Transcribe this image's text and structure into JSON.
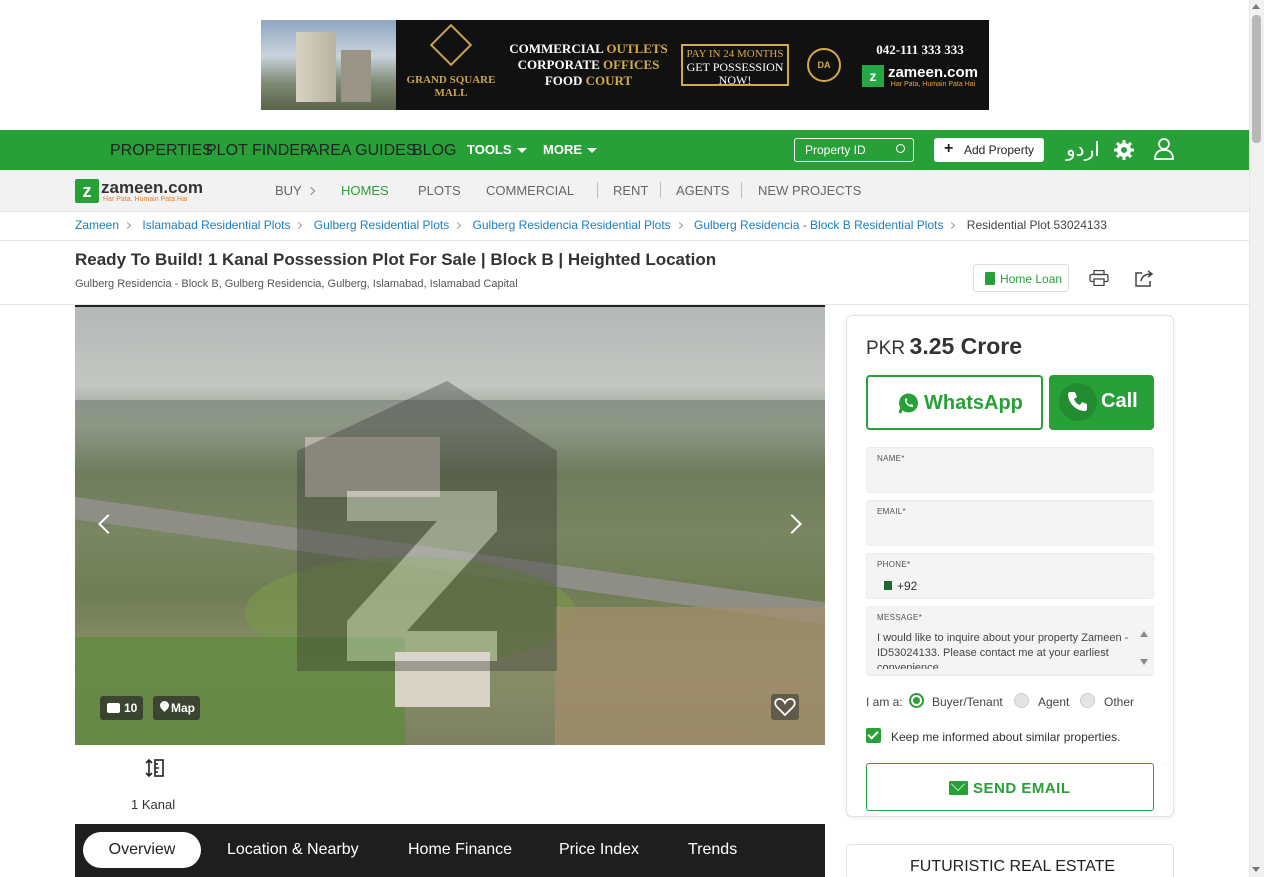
{
  "ad": {
    "logo_label": "GRAND SQUARE MALL",
    "line1_a": "COMMERCIAL",
    "line1_b": "OUTLETS",
    "line2_a": "CORPORATE",
    "line2_b": "OFFICES",
    "line3_a": "FOOD",
    "line3_b": "COURT",
    "pay_top": "PAY IN 24 MONTHS",
    "pay_bottom": "GET POSSESSION NOW!",
    "phone": "042-111 333 333",
    "brand": "zameen.com",
    "brand_tag": "Har Pata, Humain Pata Hai"
  },
  "topnav": {
    "items": [
      "PROPERTIES",
      "PLOT FINDER",
      "AREA GUIDES",
      "BLOG",
      "TOOLS",
      "MORE"
    ],
    "search_placeholder": "Property ID",
    "add_property": "Add Property",
    "urdu": "اردو"
  },
  "brand": {
    "name": "zameen.com",
    "tag": "Har Pata, Humain Pata Hai"
  },
  "subnav": {
    "items": [
      "BUY",
      "HOMES",
      "PLOTS",
      "COMMERCIAL",
      "RENT",
      "AGENTS",
      "NEW PROJECTS"
    ],
    "active": "HOMES"
  },
  "breadcrumb": {
    "links": [
      "Zameen",
      "Islamabad Residential Plots",
      "Gulberg Residential Plots",
      "Gulberg Residencia Residential Plots",
      "Gulberg Residencia - Block B Residential Plots"
    ],
    "current": "Residential Plot 53024133"
  },
  "listing": {
    "title": "Ready To Build! 1 Kanal Possession Plot For Sale | Block B | Heighted Location",
    "address": "Gulberg Residencia - Block B, Gulberg Residencia, Gulberg, Islamabad, Islamabad Capital",
    "home_loan": "Home Loan",
    "photo_count": "10",
    "map_label": "Map",
    "area": "1 Kanal"
  },
  "tabs": [
    "Overview",
    "Location & Nearby",
    "Home Finance",
    "Price Index",
    "Trends"
  ],
  "contact": {
    "currency": "PKR",
    "amount": "3.25 Crore",
    "whatsapp": "WhatsApp",
    "call": "Call",
    "name_label": "NAME*",
    "email_label": "EMAIL*",
    "phone_label": "PHONE*",
    "phone_code": "+92",
    "message_label": "MESSAGE*",
    "message": "I would like to inquire about your property Zameen - ID53024133. Please contact me at your earliest convenience.",
    "iam_label": "I am a:",
    "roles": [
      "Buyer/Tenant",
      "Agent",
      "Other"
    ],
    "selected_role": "Buyer/Tenant",
    "keep_informed": "Keep me informed about similar properties.",
    "keep_informed_checked": true,
    "send_email": "SEND EMAIL"
  },
  "promo": {
    "title": "FUTURISTIC REAL ESTATE"
  },
  "colors": {
    "brand_green": "#28a038",
    "link_blue": "#1b7ec4",
    "tab_bar": "#1e1e1e"
  },
  "icons": [
    "home-icon",
    "search-icon",
    "plus-icon",
    "gear-icon",
    "user-icon",
    "calculator-icon",
    "print-icon",
    "share-icon",
    "camera-icon",
    "map-pin-icon",
    "heart-icon",
    "area-icon",
    "whatsapp-icon",
    "phone-icon",
    "envelope-icon"
  ]
}
